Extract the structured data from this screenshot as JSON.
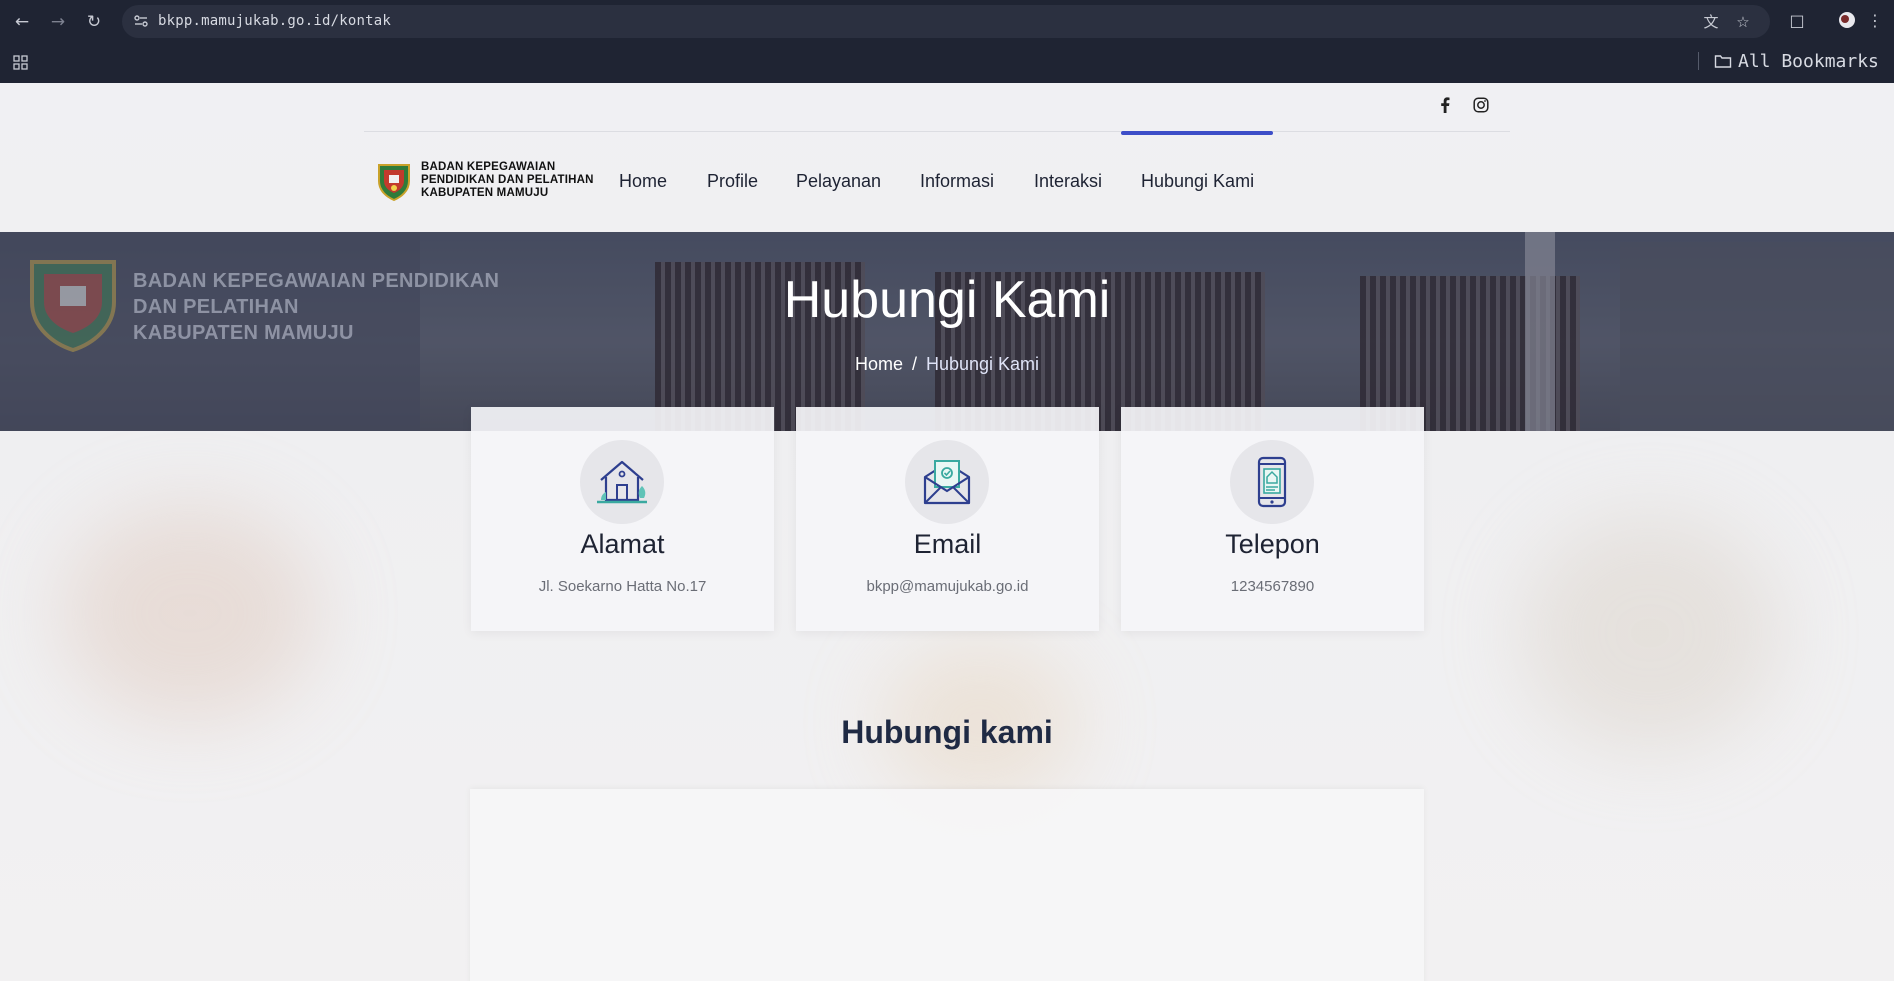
{
  "browser": {
    "url": "bkpp.mamujukab.go.id/kontak",
    "bookmarks_label": "All Bookmarks"
  },
  "header": {
    "logo_lines": [
      "BADAN KEPEGAWAIAN",
      "PENDIDIKAN DAN PELATIHAN",
      "KABUPATEN MAMUJU"
    ],
    "nav": [
      "Home",
      "Profile",
      "Pelayanan",
      "Informasi",
      "Interaksi",
      "Hubungi Kami"
    ],
    "active_nav": "Hubungi Kami",
    "social_icons": [
      "facebook-icon",
      "instagram-icon"
    ],
    "accent_color": "#3d4ec8"
  },
  "hero": {
    "brand_lines": [
      "BADAN KEPEGAWAIAN PENDIDIKAN",
      "DAN PELATIHAN",
      "KABUPATEN MAMUJU"
    ],
    "title": "Hubungi Kami",
    "breadcrumb": [
      "Home",
      "/",
      "Hubungi Kami"
    ]
  },
  "contacts": [
    {
      "icon": "house-icon",
      "title": "Alamat",
      "value": "Jl. Soekarno Hatta No.17"
    },
    {
      "icon": "envelope-icon",
      "title": "Email",
      "value": "bkpp@mamujukab.go.id"
    },
    {
      "icon": "smartphone-icon",
      "title": "Telepon",
      "value": "1234567890"
    }
  ],
  "form_section": {
    "title": "Hubungi kami"
  }
}
